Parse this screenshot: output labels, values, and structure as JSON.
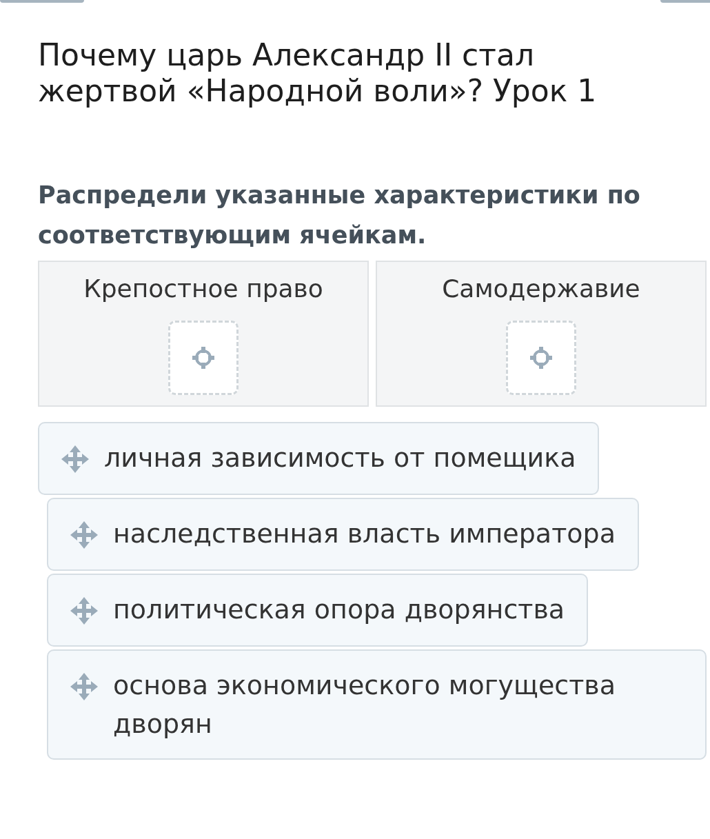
{
  "title": "Почему царь Александр II стал жертвой «Народной воли»? Урок 1",
  "instruction": "Распредели указанные характеристики по соответствующим ячейкам.",
  "columns": [
    {
      "heading": "Крепостное право"
    },
    {
      "heading": "Самодержавие"
    }
  ],
  "cards": [
    {
      "text": "личная зависимость от помещика"
    },
    {
      "text": "наследственная власть императора"
    },
    {
      "text": "политическая опора дворянства"
    },
    {
      "text": "основа экономического могущества дворян"
    }
  ]
}
